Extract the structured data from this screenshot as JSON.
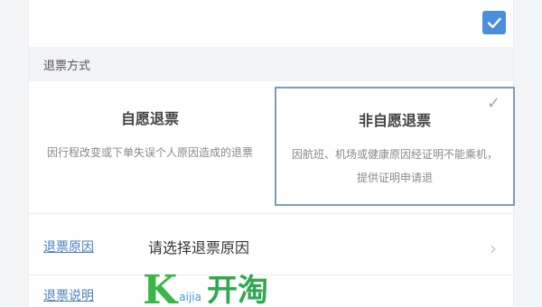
{
  "checkbox": {
    "checked": true
  },
  "section": {
    "title": "退票方式"
  },
  "options": [
    {
      "title": "自愿退票",
      "desc": "因行程改变或下单失误个人原因造成的退票",
      "selected": false
    },
    {
      "title": "非自愿退票",
      "desc": "因航班、机场或健康原因经证明不能乘机，提供证明申请退",
      "selected": true
    }
  ],
  "reason": {
    "label": "退票原因",
    "placeholder": "请选择退票原因"
  },
  "description": {
    "label": "退票说明"
  },
  "watermark": {
    "brand_k": "K",
    "small": "aijia",
    "big": "开淘"
  },
  "colors": {
    "accent": "#4a8fdb",
    "selected_border": "#7f9cba",
    "link": "#4a7fc1"
  }
}
